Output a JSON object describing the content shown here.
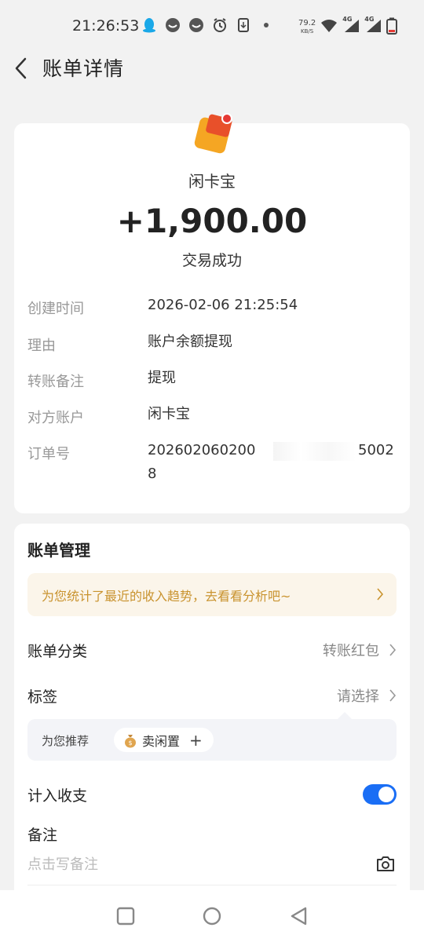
{
  "status_bar": {
    "time": "21:26:53",
    "speed_value": "79.2",
    "speed_unit": "KB/S",
    "signal1": "4G",
    "signal2": "4G"
  },
  "header": {
    "title": "账单详情"
  },
  "summary": {
    "merchant": "闲卡宝",
    "amount": "+1,900.00",
    "status": "交易成功"
  },
  "details": [
    {
      "label": "创建时间",
      "value": "2026-02-06 21:25:54"
    },
    {
      "label": "理由",
      "value": "账户余额提现"
    },
    {
      "label": "转账备注",
      "value": "提现"
    },
    {
      "label": "对方账户",
      "value": "闲卡宝"
    },
    {
      "label": "订单号",
      "value": "20260206020078████████████500028"
    }
  ],
  "order_no_visible": {
    "line1_start": "202602060200",
    "line1_end": "5002",
    "line2": "8"
  },
  "manage": {
    "title": "账单管理",
    "banner_text": "为您统计了最近的收入趋势，去看看分析吧~",
    "category_label": "账单分类",
    "category_value": "转账红包",
    "tag_label": "标签",
    "tag_value": "请选择",
    "recommend_label": "为您推荐",
    "recommend_chip": "卖闲置",
    "include_label": "计入收支",
    "include_on": true,
    "note_label": "备注",
    "note_placeholder": "点击写备注"
  },
  "colors": {
    "accent": "#1a6ef5",
    "banner_text": "#c9932f",
    "banner_bg": "#fbf5ea",
    "logo_orange": "#f5a623",
    "logo_red": "#e8502a"
  }
}
